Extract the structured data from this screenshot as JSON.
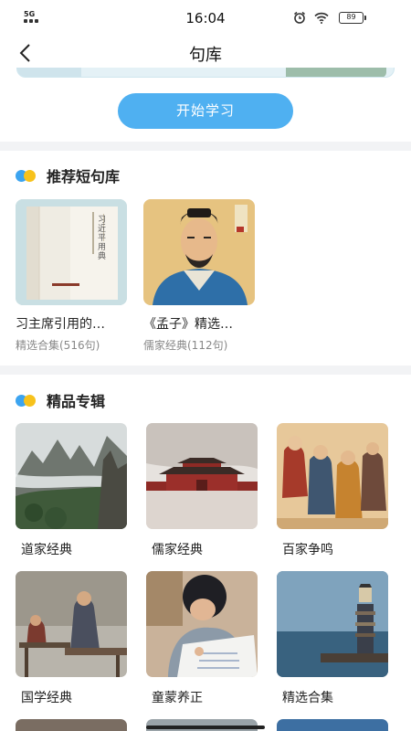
{
  "status_bar": {
    "network": "5G",
    "time": "16:04",
    "battery": "89"
  },
  "nav": {
    "title": "句库"
  },
  "start_button": "开始学习",
  "recommended": {
    "title": "推荐短句库",
    "items": [
      {
        "title": "习主席引用的…",
        "subtitle": "精选合集(516句)",
        "cover_text": "习近平用典"
      },
      {
        "title": "《孟子》精选…",
        "subtitle": "儒家经典(112句)"
      }
    ]
  },
  "albums": {
    "title": "精品专辑",
    "items": [
      {
        "title": "道家经典"
      },
      {
        "title": "儒家经典"
      },
      {
        "title": "百家争鸣"
      },
      {
        "title": "国学经典"
      },
      {
        "title": "童蒙养正"
      },
      {
        "title": "精选合集"
      }
    ]
  },
  "colors": {
    "accent": "#4fb0f1",
    "dot_blue": "#3ca4f0",
    "dot_yellow": "#f7c21c"
  }
}
